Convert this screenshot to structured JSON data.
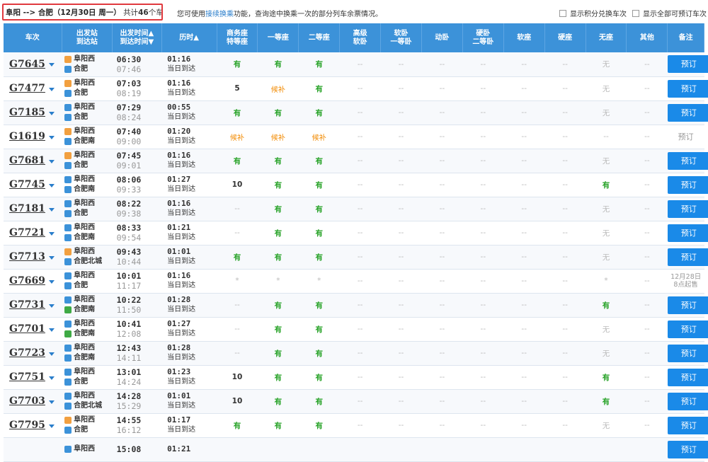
{
  "header": {
    "route": "阜阳 --> 合肥（12月30日  周一）",
    "count_prefix": "共计",
    "count": "46",
    "count_suffix": "个车次",
    "tip_before": "您可使用",
    "tip_link": "接续换乘",
    "tip_after": "功能，查询途中换乘一次的部分列车余票情况。",
    "chk_points": "显示积分兑换车次",
    "chk_all": "显示全部可预订车次"
  },
  "columns": [
    "车次",
    "出发站\n到达站",
    "出发时间▲\n到达时间▼",
    "历时▲",
    "商务座\n特等座",
    "一等座",
    "二等座",
    "高级\n软卧",
    "软卧\n一等卧",
    "动卧",
    "硬卧\n二等卧",
    "软座",
    "硬座",
    "无座",
    "其他",
    "备注"
  ],
  "rows": [
    {
      "train": "G7645",
      "from": "阜阳西",
      "to": "合肥",
      "from_type": "start",
      "to_type": "pass",
      "dep": "06:30",
      "arr": "07:46",
      "dur": "01:16",
      "day": "当日到达",
      "seats": [
        "有",
        "有",
        "有",
        "--",
        "--",
        "--",
        "--",
        "--",
        "--",
        "无",
        "--"
      ],
      "action": "预订"
    },
    {
      "train": "G7477",
      "from": "阜阳西",
      "to": "合肥",
      "from_type": "start",
      "to_type": "pass",
      "dep": "07:03",
      "arr": "08:19",
      "dur": "01:16",
      "day": "当日到达",
      "seats": [
        "5",
        "候补",
        "有",
        "--",
        "--",
        "--",
        "--",
        "--",
        "--",
        "无",
        "--"
      ],
      "action": "预订"
    },
    {
      "train": "G7185",
      "from": "阜阳西",
      "to": "合肥",
      "from_type": "pass",
      "to_type": "pass",
      "dep": "07:29",
      "arr": "08:24",
      "dur": "00:55",
      "day": "当日到达",
      "seats": [
        "有",
        "有",
        "有",
        "--",
        "--",
        "--",
        "--",
        "--",
        "--",
        "无",
        "--"
      ],
      "action": "预订"
    },
    {
      "train": "G1619",
      "from": "阜阳西",
      "to": "合肥南",
      "from_type": "start",
      "to_type": "pass",
      "dep": "07:40",
      "arr": "09:00",
      "dur": "01:20",
      "day": "当日到达",
      "seats": [
        "候补",
        "候补",
        "候补",
        "--",
        "--",
        "--",
        "--",
        "--",
        "--",
        "--",
        "--"
      ],
      "action": "预订",
      "disabled": true
    },
    {
      "train": "G7681",
      "from": "阜阳西",
      "to": "合肥",
      "from_type": "start",
      "to_type": "pass",
      "dep": "07:45",
      "arr": "09:01",
      "dur": "01:16",
      "day": "当日到达",
      "seats": [
        "有",
        "有",
        "有",
        "--",
        "--",
        "--",
        "--",
        "--",
        "--",
        "无",
        "--"
      ],
      "action": "预订"
    },
    {
      "train": "G7745",
      "from": "阜阳西",
      "to": "合肥南",
      "from_type": "pass",
      "to_type": "pass",
      "dep": "08:06",
      "arr": "09:33",
      "dur": "01:27",
      "day": "当日到达",
      "seats": [
        "10",
        "有",
        "有",
        "--",
        "--",
        "--",
        "--",
        "--",
        "--",
        "有",
        "--"
      ],
      "action": "预订"
    },
    {
      "train": "G7181",
      "from": "阜阳西",
      "to": "合肥",
      "from_type": "pass",
      "to_type": "pass",
      "dep": "08:22",
      "arr": "09:38",
      "dur": "01:16",
      "day": "当日到达",
      "seats": [
        "--",
        "有",
        "有",
        "--",
        "--",
        "--",
        "--",
        "--",
        "--",
        "无",
        "--"
      ],
      "action": "预订"
    },
    {
      "train": "G7721",
      "from": "阜阳西",
      "to": "合肥南",
      "from_type": "pass",
      "to_type": "pass",
      "dep": "08:33",
      "arr": "09:54",
      "dur": "01:21",
      "day": "当日到达",
      "seats": [
        "--",
        "有",
        "有",
        "--",
        "--",
        "--",
        "--",
        "--",
        "--",
        "无",
        "--"
      ],
      "action": "预订"
    },
    {
      "train": "G7713",
      "from": "阜阳西",
      "to": "合肥北城",
      "from_type": "start",
      "to_type": "pass",
      "dep": "09:43",
      "arr": "10:44",
      "dur": "01:01",
      "day": "当日到达",
      "seats": [
        "有",
        "有",
        "有",
        "--",
        "--",
        "--",
        "--",
        "--",
        "--",
        "无",
        "--"
      ],
      "action": "预订"
    },
    {
      "train": "G7669",
      "from": "阜阳西",
      "to": "合肥",
      "from_type": "pass",
      "to_type": "pass",
      "dep": "10:01",
      "arr": "11:17",
      "dur": "01:16",
      "day": "当日到达",
      "seats": [
        "*",
        "*",
        "*",
        "--",
        "--",
        "--",
        "--",
        "--",
        "--",
        "*",
        "--"
      ],
      "action": "12月28日\n8点起售",
      "disabled": true,
      "note": true
    },
    {
      "train": "G7731",
      "from": "阜阳西",
      "to": "合肥南",
      "from_type": "pass",
      "to_type": "end",
      "dep": "10:22",
      "arr": "11:50",
      "dur": "01:28",
      "day": "当日到达",
      "seats": [
        "--",
        "有",
        "有",
        "--",
        "--",
        "--",
        "--",
        "--",
        "--",
        "有",
        "--"
      ],
      "action": "预订"
    },
    {
      "train": "G7701",
      "from": "阜阳西",
      "to": "合肥南",
      "from_type": "pass",
      "to_type": "end",
      "dep": "10:41",
      "arr": "12:08",
      "dur": "01:27",
      "day": "当日到达",
      "seats": [
        "--",
        "有",
        "有",
        "--",
        "--",
        "--",
        "--",
        "--",
        "--",
        "无",
        "--"
      ],
      "action": "预订"
    },
    {
      "train": "G7723",
      "from": "阜阳西",
      "to": "合肥南",
      "from_type": "pass",
      "to_type": "pass",
      "dep": "12:43",
      "arr": "14:11",
      "dur": "01:28",
      "day": "当日到达",
      "seats": [
        "--",
        "有",
        "有",
        "--",
        "--",
        "--",
        "--",
        "--",
        "--",
        "无",
        "--"
      ],
      "action": "预订"
    },
    {
      "train": "G7751",
      "from": "阜阳西",
      "to": "合肥",
      "from_type": "pass",
      "to_type": "pass",
      "dep": "13:01",
      "arr": "14:24",
      "dur": "01:23",
      "day": "当日到达",
      "seats": [
        "10",
        "有",
        "有",
        "--",
        "--",
        "--",
        "--",
        "--",
        "--",
        "有",
        "--"
      ],
      "action": "预订"
    },
    {
      "train": "G7703",
      "from": "阜阳西",
      "to": "合肥北城",
      "from_type": "pass",
      "to_type": "pass",
      "dep": "14:28",
      "arr": "15:29",
      "dur": "01:01",
      "day": "当日到达",
      "seats": [
        "10",
        "有",
        "有",
        "--",
        "--",
        "--",
        "--",
        "--",
        "--",
        "有",
        "--"
      ],
      "action": "预订"
    },
    {
      "train": "G7795",
      "from": "阜阳西",
      "to": "合肥",
      "from_type": "start",
      "to_type": "pass",
      "dep": "14:55",
      "arr": "16:12",
      "dur": "01:17",
      "day": "当日到达",
      "seats": [
        "有",
        "有",
        "有",
        "--",
        "--",
        "--",
        "--",
        "--",
        "--",
        "无",
        "--"
      ],
      "action": "预订"
    },
    {
      "train": "",
      "from": "阜阳西",
      "to": "",
      "from_type": "pass",
      "to_type": "pass",
      "dep": "15:08",
      "arr": "",
      "dur": "01:21",
      "day": "",
      "seats": [
        "",
        "",
        "",
        "",
        "",
        "",
        "",
        "",
        "",
        "",
        ""
      ],
      "action": "预订"
    }
  ]
}
